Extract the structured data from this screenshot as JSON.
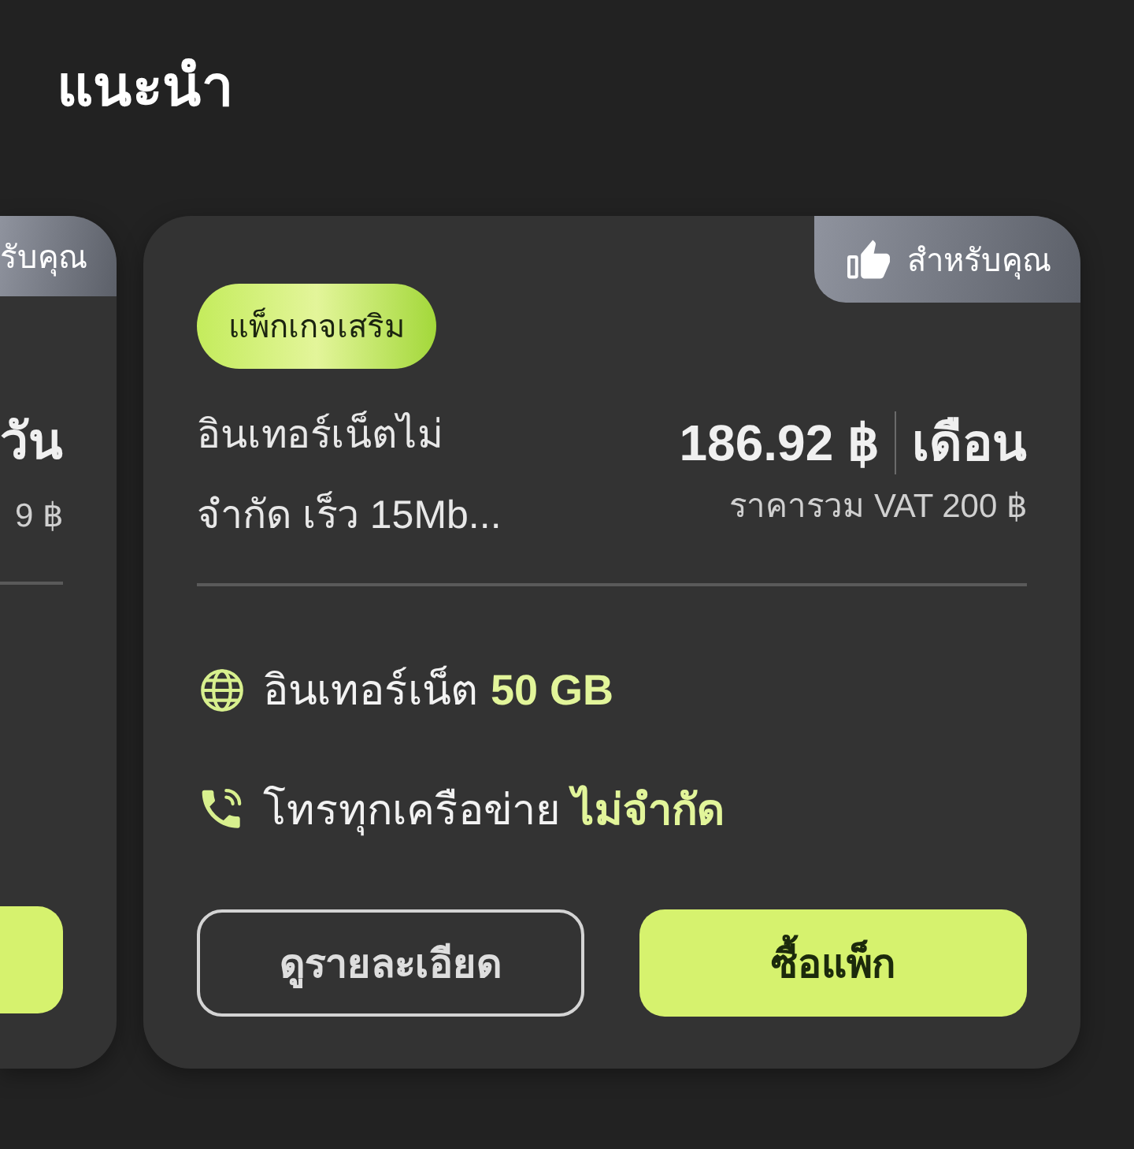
{
  "section_title": "แนะนำ",
  "cards": [
    {
      "kind": "partial",
      "badge": "รับคุณ",
      "period": "วัน",
      "price_note": "9 ฿",
      "buttons": [
        {
          "kind": "primary"
        }
      ]
    },
    {
      "kind": "full",
      "badge": "สำหรับคุณ",
      "tag": "แพ็กเกจเสริม",
      "title": "อินเทอร์เน็ตไม่\nจำกัด เร็ว 15Mb...",
      "price": "186.92 ฿",
      "period": "เดือน",
      "price_note": "ราคารวม VAT 200 ฿",
      "features": [
        {
          "kind": "internet",
          "text": "อินเทอร์เน็ต **50 GB**"
        },
        {
          "kind": "call",
          "text": "โทรทุกเครือข่าย **ไม่จำกัด**"
        }
      ],
      "buttons": [
        {
          "kind": "outline",
          "label": "ดูรายละเอียด"
        },
        {
          "kind": "primary",
          "label": "ซื้อแพ็ก"
        }
      ]
    }
  ]
}
